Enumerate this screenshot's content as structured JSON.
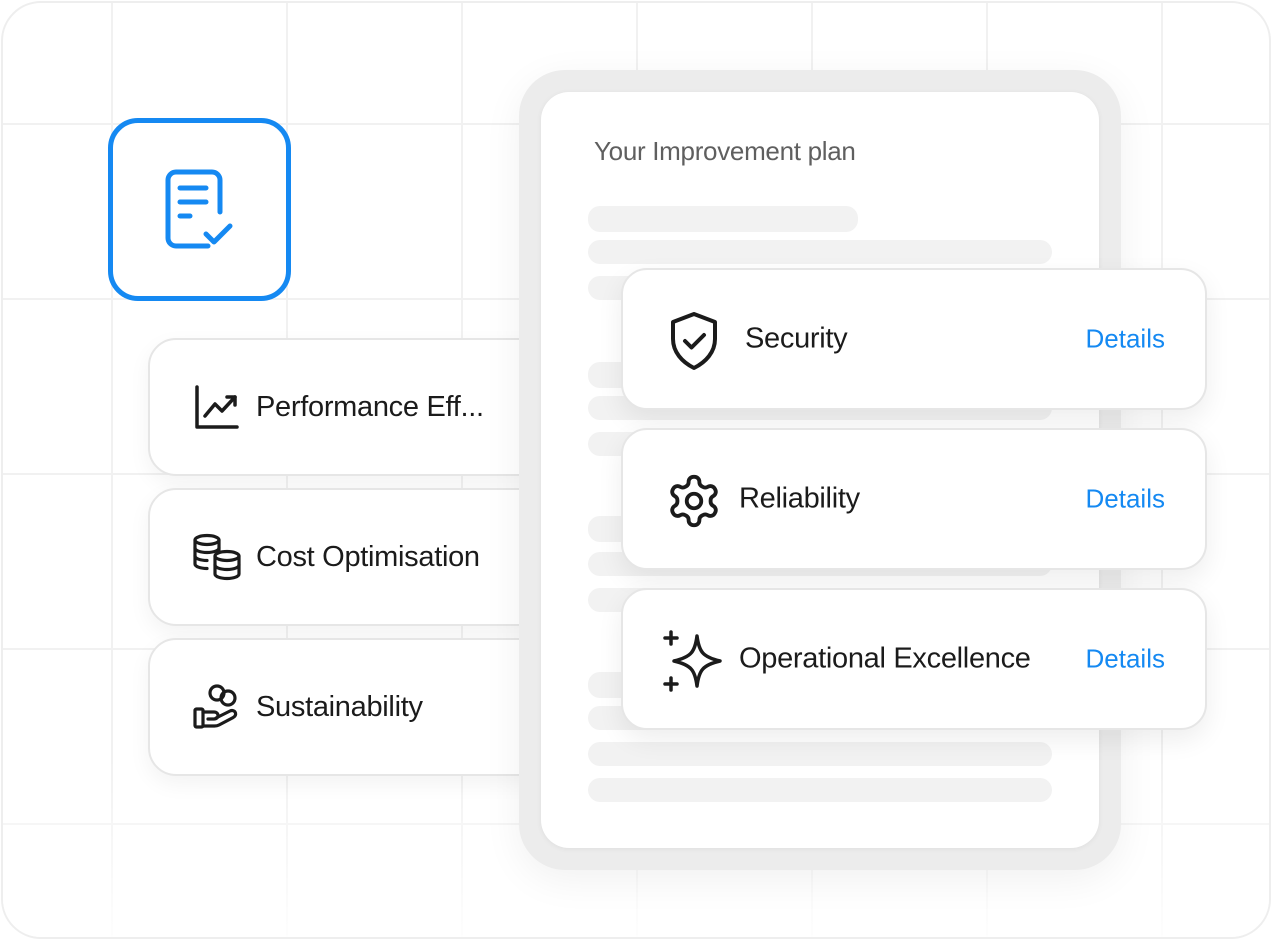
{
  "plan": {
    "title": "Your Improvement plan"
  },
  "pillars": [
    {
      "label": "Performance Eff...",
      "icon": "trending-chart-icon"
    },
    {
      "label": "Cost Optimisation",
      "icon": "coin-stack-icon"
    },
    {
      "label": "Sustainability",
      "icon": "hand-coins-icon"
    }
  ],
  "items": [
    {
      "label": "Security",
      "details": "Details",
      "icon": "shield-check-icon"
    },
    {
      "label": "Reliability",
      "details": "Details",
      "icon": "gear-icon"
    },
    {
      "label": "Operational Excellence",
      "details": "Details",
      "icon": "sparkle-icon"
    }
  ],
  "colors": {
    "accent": "#1589f2",
    "text": "#1b1b1b",
    "muted": "#5f5f5f"
  }
}
